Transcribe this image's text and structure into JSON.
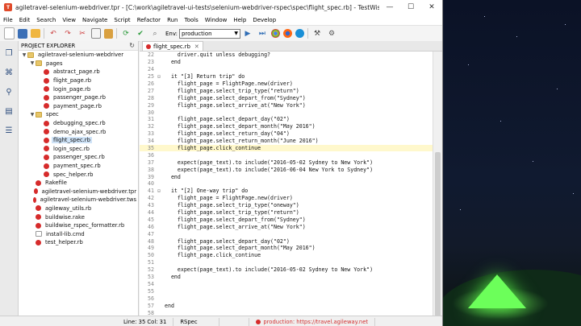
{
  "window": {
    "title": "agiletravel-selenium-webdriver.tpr - [C:\\work\\agiletravel-ui-tests\\selenium-webdriver-rspec\\spec\\flight_spec.rb] - TestWise 6.6.5",
    "minimize": "—",
    "maximize": "☐",
    "close": "✕"
  },
  "menu": [
    "File",
    "Edit",
    "Search",
    "View",
    "Navigate",
    "Script",
    "Refactor",
    "Run",
    "Tools",
    "Window",
    "Help",
    "Develop"
  ],
  "toolbar": {
    "env_label": "Env:",
    "env_value": "production"
  },
  "explorer": {
    "title": "PROJECT EXPLORER",
    "items": [
      {
        "label": "agiletravel-selenium-webdriver",
        "type": "folder",
        "twisty": "▼",
        "indent": 0
      },
      {
        "label": "pages",
        "type": "folder",
        "twisty": "▼",
        "indent": 1
      },
      {
        "label": "abstract_page.rb",
        "type": "rb",
        "twisty": "",
        "indent": 2
      },
      {
        "label": "flight_page.rb",
        "type": "rb",
        "twisty": "",
        "indent": 2
      },
      {
        "label": "login_page.rb",
        "type": "rb",
        "twisty": "",
        "indent": 2
      },
      {
        "label": "passenger_page.rb",
        "type": "rb",
        "twisty": "",
        "indent": 2
      },
      {
        "label": "payment_page.rb",
        "type": "rb",
        "twisty": "",
        "indent": 2
      },
      {
        "label": "spec",
        "type": "folder",
        "twisty": "▼",
        "indent": 1
      },
      {
        "label": "debugging_spec.rb",
        "type": "rb",
        "twisty": "",
        "indent": 2
      },
      {
        "label": "demo_ajax_spec.rb",
        "type": "rb",
        "twisty": "",
        "indent": 2
      },
      {
        "label": "flight_spec.rb",
        "type": "rb",
        "twisty": "",
        "indent": 2,
        "selected": true
      },
      {
        "label": "login_spec.rb",
        "type": "rb",
        "twisty": "",
        "indent": 2
      },
      {
        "label": "passenger_spec.rb",
        "type": "rb",
        "twisty": "",
        "indent": 2
      },
      {
        "label": "payment_spec.rb",
        "type": "rb",
        "twisty": "",
        "indent": 2
      },
      {
        "label": "spec_helper.rb",
        "type": "rb",
        "twisty": "",
        "indent": 2
      },
      {
        "label": "Rakefile",
        "type": "rb",
        "twisty": "",
        "indent": 1
      },
      {
        "label": "agiletravel-selenium-webdriver.tpr",
        "type": "rb",
        "twisty": "",
        "indent": 1
      },
      {
        "label": "agiletravel-selenium-webdriver.tws",
        "type": "rb",
        "twisty": "",
        "indent": 1
      },
      {
        "label": "agileway_utils.rb",
        "type": "rb",
        "twisty": "",
        "indent": 1
      },
      {
        "label": "buildwise.rake",
        "type": "rb",
        "twisty": "",
        "indent": 1
      },
      {
        "label": "buildwise_rspec_formatter.rb",
        "type": "rb",
        "twisty": "",
        "indent": 1
      },
      {
        "label": "install-lib.cmd",
        "type": "file",
        "twisty": "",
        "indent": 1
      },
      {
        "label": "test_helper.rb",
        "type": "rb",
        "twisty": "",
        "indent": 1
      }
    ]
  },
  "editor": {
    "tab_label": "flight_spec.rb",
    "tab_close": "✕",
    "lines": [
      {
        "n": "22",
        "g": "",
        "t": "    driver.quit unless debugging?"
      },
      {
        "n": "23",
        "g": "",
        "t": "  end"
      },
      {
        "n": "24",
        "g": "",
        "t": ""
      },
      {
        "n": "25",
        "g": "⊟",
        "t": "  it \"[3] Return trip\" do"
      },
      {
        "n": "26",
        "g": "",
        "t": "    flight_page = FlightPage.new(driver)"
      },
      {
        "n": "27",
        "g": "",
        "t": "    flight_page.select_trip_type(\"return\")"
      },
      {
        "n": "28",
        "g": "",
        "t": "    flight_page.select_depart_from(\"Sydney\")"
      },
      {
        "n": "29",
        "g": "",
        "t": "    flight_page.select_arrive_at(\"New York\")"
      },
      {
        "n": "30",
        "g": "",
        "t": ""
      },
      {
        "n": "31",
        "g": "",
        "t": "    flight_page.select_depart_day(\"02\")"
      },
      {
        "n": "32",
        "g": "",
        "t": "    flight_page.select_depart_month(\"May 2016\")"
      },
      {
        "n": "33",
        "g": "",
        "t": "    flight_page.select_return_day(\"04\")"
      },
      {
        "n": "34",
        "g": "",
        "t": "    flight_page.select_return_month(\"June 2016\")"
      },
      {
        "n": "35",
        "g": "",
        "t": "    flight_page.click_continue",
        "current": true
      },
      {
        "n": "36",
        "g": "",
        "t": ""
      },
      {
        "n": "37",
        "g": "",
        "t": "    expect(page_text).to include(\"2016-05-02 Sydney to New York\")"
      },
      {
        "n": "38",
        "g": "",
        "t": "    expect(page_text).to include(\"2016-06-04 New York to Sydney\")"
      },
      {
        "n": "39",
        "g": "",
        "t": "  end"
      },
      {
        "n": "40",
        "g": "",
        "t": ""
      },
      {
        "n": "41",
        "g": "⊟",
        "t": "  it \"[2] One-way trip\" do"
      },
      {
        "n": "42",
        "g": "",
        "t": "    flight_page = FlightPage.new(driver)"
      },
      {
        "n": "43",
        "g": "",
        "t": "    flight_page.select_trip_type(\"oneway\")"
      },
      {
        "n": "44",
        "g": "",
        "t": "    flight_page.select_trip_type(\"return\")"
      },
      {
        "n": "45",
        "g": "",
        "t": "    flight_page.select_depart_from(\"Sydney\")"
      },
      {
        "n": "46",
        "g": "",
        "t": "    flight_page.select_arrive_at(\"New York\")"
      },
      {
        "n": "47",
        "g": "",
        "t": ""
      },
      {
        "n": "48",
        "g": "",
        "t": "    flight_page.select_depart_day(\"02\")"
      },
      {
        "n": "49",
        "g": "",
        "t": "    flight_page.select_depart_month(\"May 2016\")"
      },
      {
        "n": "50",
        "g": "",
        "t": "    flight_page.click_continue"
      },
      {
        "n": "51",
        "g": "",
        "t": ""
      },
      {
        "n": "52",
        "g": "",
        "t": "    expect(page_text).to include(\"2016-05-02 Sydney to New York\")"
      },
      {
        "n": "53",
        "g": "",
        "t": "  end"
      },
      {
        "n": "54",
        "g": "",
        "t": ""
      },
      {
        "n": "55",
        "g": "",
        "t": ""
      },
      {
        "n": "56",
        "g": "",
        "t": ""
      },
      {
        "n": "57",
        "g": "",
        "t": "end"
      },
      {
        "n": "58",
        "g": "",
        "t": ""
      }
    ]
  },
  "status": {
    "position": "Line: 35  Col: 31",
    "framework": "RSpec",
    "env": "production: https://travel.agileway.net"
  },
  "colors": {
    "accent": "#2f6db5",
    "ruby": "#d62b2b",
    "current_line": "#fff8cc",
    "env_status": "#d13232"
  }
}
